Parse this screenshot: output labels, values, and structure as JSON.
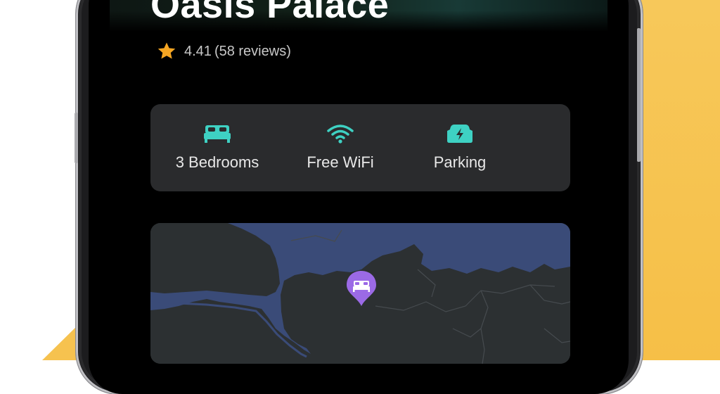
{
  "property": {
    "name": "Oasis Palace",
    "rating": "4.41",
    "reviews": "(58 reviews)"
  },
  "amenities": [
    {
      "icon": "bed-icon",
      "label": "3 Bedrooms"
    },
    {
      "icon": "wifi-icon",
      "label": "Free WiFi"
    },
    {
      "icon": "parking-icon",
      "label": "Parking"
    }
  ],
  "map": {
    "pin_icon": "bed-pin-icon"
  },
  "colors": {
    "accent_teal": "#3ed1c3",
    "star": "#f6a623",
    "pin": "#9b6ae6",
    "water": "#3a4b78",
    "land": "#2c3032",
    "background_yellow": "#f6c24f"
  }
}
